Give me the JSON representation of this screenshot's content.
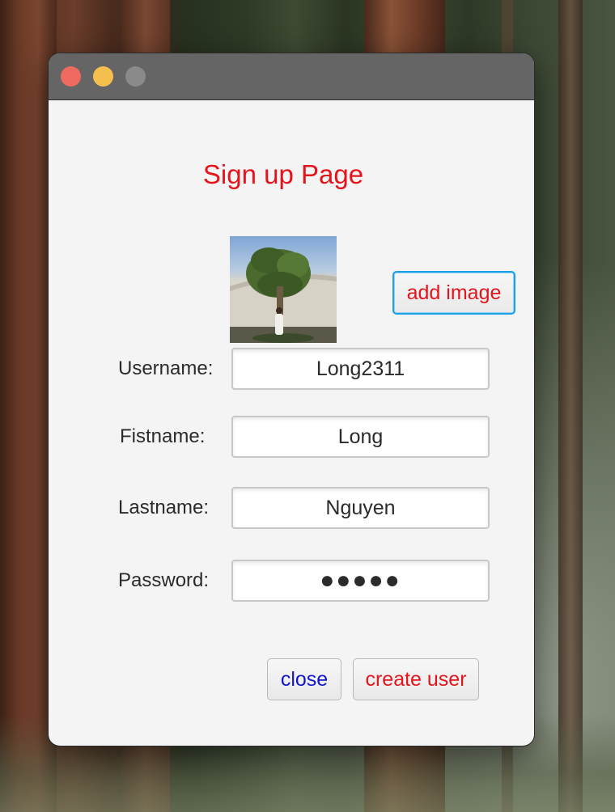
{
  "window": {
    "controls": {
      "close": "close-window",
      "minimize": "minimize-window",
      "maximize": "maximize-window"
    }
  },
  "page": {
    "title": "Sign up Page"
  },
  "profile": {
    "image_alt": "profile photo",
    "add_image_label": "add image"
  },
  "form": {
    "username": {
      "label": "Username:",
      "value": "Long2311"
    },
    "firstname": {
      "label": "Fistname:",
      "value": "Long"
    },
    "lastname": {
      "label": "Lastname:",
      "value": "Nguyen"
    },
    "password": {
      "label": "Password:",
      "value": "●●●●●"
    }
  },
  "actions": {
    "close_label": "close",
    "create_label": "create user"
  },
  "colors": {
    "title_red": "#e3141b",
    "close_blue": "#1216c8",
    "focus_ring": "#1fa0e6",
    "titlebar": "#656565"
  }
}
